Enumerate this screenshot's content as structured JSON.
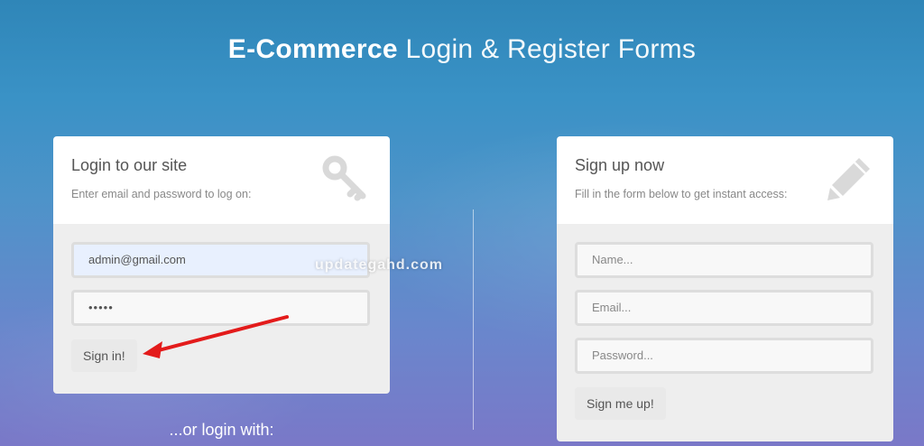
{
  "page": {
    "title_strong": "E-Commerce",
    "title_light": "Login & Register Forms"
  },
  "login": {
    "title": "Login to our site",
    "subtitle": "Enter email and password to log on:",
    "icon": "key-icon",
    "email_value": "admin@gmail.com",
    "password_value": "•••••",
    "submit_label": "Sign in!",
    "or_text": "...or login with:"
  },
  "signup": {
    "title": "Sign up now",
    "subtitle": "Fill in the form below to get instant access:",
    "icon": "pencil-icon",
    "name_placeholder": "Name...",
    "email_placeholder": "Email...",
    "password_placeholder": "Password...",
    "submit_label": "Sign me up!"
  },
  "watermark": "updategahd.com",
  "colors": {
    "bg_top": "#2f86b8",
    "bg_bottom": "#7a78c8",
    "card_head": "#ffffff",
    "card_body": "#eeeeee",
    "annotation_arrow": "#e31b1b"
  }
}
